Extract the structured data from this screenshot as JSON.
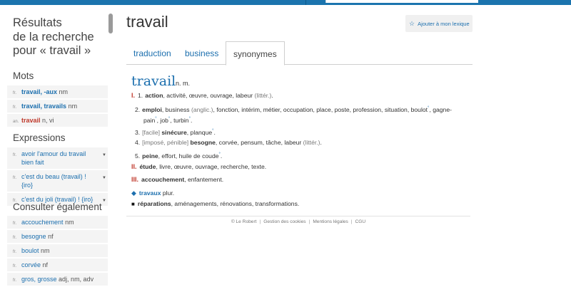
{
  "sidebar": {
    "results_title": [
      "Résultats",
      "de la recherche",
      "pour « travail »"
    ],
    "mots": {
      "heading": "Mots",
      "items": [
        {
          "lang": "fr.",
          "term": "travail, -aux",
          "gram": "nm"
        },
        {
          "lang": "fr.",
          "term": "travail, travails",
          "gram": "nm"
        },
        {
          "lang": "an.",
          "term": "travail",
          "gram": "n, vi"
        }
      ]
    },
    "expressions": {
      "heading": "Expressions",
      "items": [
        {
          "lang": "fr.",
          "term": "avoir l'amour du travail bien fait"
        },
        {
          "lang": "fr.",
          "term": "c'est du beau (travail) ! {iro}"
        },
        {
          "lang": "fr.",
          "term": "c'est du joli (travail) ! {iro}"
        }
      ]
    },
    "consulter": {
      "heading": "Consulter également",
      "items": [
        {
          "lang": "fr.",
          "term": "accouchement",
          "gram": "nm"
        },
        {
          "lang": "fr.",
          "term": "besogne",
          "gram": "nf"
        },
        {
          "lang": "fr.",
          "term": "boulot",
          "gram": "nm"
        },
        {
          "lang": "fr.",
          "term": "corvée",
          "gram": "nf"
        },
        {
          "lang": "fr.",
          "term": "gros, grosse",
          "gram": "adj, nm, adv"
        }
      ]
    }
  },
  "main": {
    "title": "travail",
    "lexique_button": "Ajouter à mon lexique",
    "tabs": [
      "traduction",
      "business",
      "synonymes"
    ],
    "active_tab": "synonymes",
    "headword": "travail",
    "headword_cat": "n. m.",
    "defs": {
      "I": {
        "roman": "I.",
        "senses": {
          "s1": {
            "num": "1.",
            "main": "action",
            "rest": ", activité, œuvre, ouvrage, labeur",
            "register": "(littér.)",
            "end": "."
          },
          "s2": {
            "num": "2.",
            "main": "emploi",
            "rest": ", business",
            "register": "(anglic.)",
            "rest2": ", fonction, intérim, métier, occupation, place, poste, profession, situation, boulot",
            "rest3": ", gagne-",
            "rest4": "pain",
            "rest5": ", job",
            "rest6": ", turbin",
            "end": "."
          },
          "s3": {
            "num": "3.",
            "register": "[facile]",
            "main": "sinécure",
            "rest": ", planque",
            "end": "."
          },
          "s4": {
            "num": "4.",
            "register": "[imposé, pénible]",
            "main": "besogne",
            "rest": ", corvée, pensum, tâche, labeur",
            "register2": "(littér.)",
            "end": "."
          },
          "s5": {
            "num": "5.",
            "main": "peine",
            "rest": ", effort, huile de coude",
            "end": "."
          }
        }
      },
      "II": {
        "roman": "II.",
        "main": "étude",
        "rest": ", livre, œuvre, ouvrage, recherche, texte."
      },
      "III": {
        "roman": "III.",
        "main": "accouchement",
        "rest": ", enfantement."
      },
      "travaux": {
        "main": "travaux",
        "rest": "plur."
      },
      "reparations": {
        "main": "réparations",
        "rest": ", aménagements, rénovations, transformations."
      }
    },
    "sup_mark": "°",
    "footer": [
      "© Le Robert",
      "Gestion des cookies",
      "Mentions légales",
      "CGU"
    ],
    "footer_sep": "|"
  },
  "colors": {
    "brand": "#1b74ae",
    "link": "#1c6fae",
    "roman": "#c0392b"
  }
}
